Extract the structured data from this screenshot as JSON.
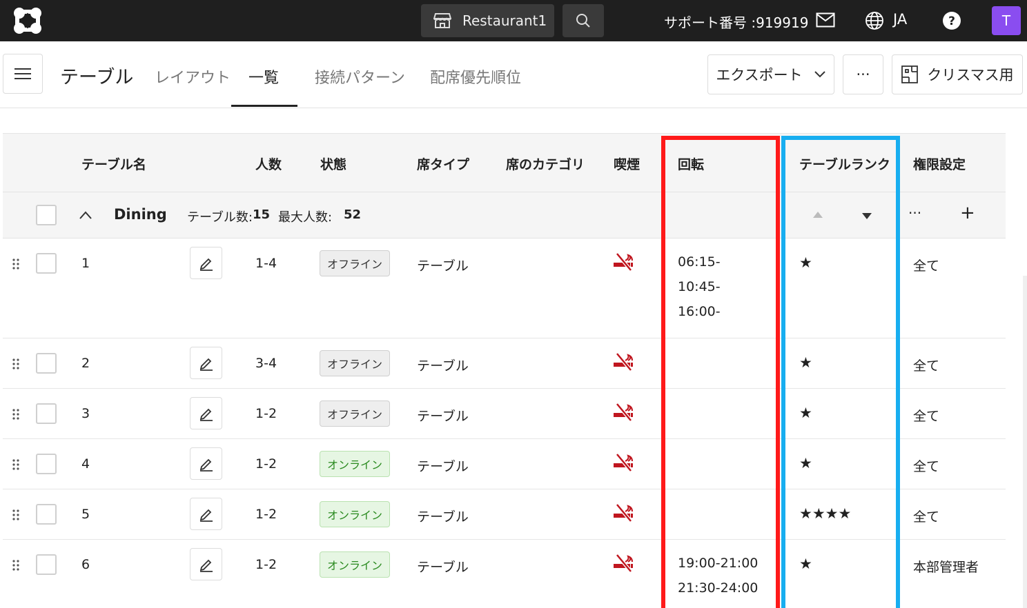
{
  "topbar": {
    "store_name": "Restaurant1",
    "support_label": "サポート番号 :919919",
    "language": "JA",
    "avatar_initial": "T",
    "avatar_color": "#8a4df0"
  },
  "header": {
    "title": "テーブル",
    "tabs": [
      {
        "label": "レイアウト"
      },
      {
        "label": "一覧"
      },
      {
        "label": "接続パターン"
      },
      {
        "label": "配席優先順位"
      }
    ],
    "export_label": "エクスポート",
    "more_label": "···",
    "pattern_label": "クリスマス用"
  },
  "table": {
    "columns": {
      "name": "テーブル名",
      "people": "人数",
      "status": "状態",
      "seat_type": "席タイプ",
      "seat_category": "席のカテゴリ",
      "smoking": "喫煙",
      "rotation": "回転",
      "rank": "テーブルランク",
      "permission": "権限設定"
    },
    "group": {
      "name": "Dining",
      "count_label": "テーブル数:",
      "count_value": "15",
      "max_label": "最大人数:",
      "max_value": "52",
      "more_label": "···",
      "add_label": "+"
    },
    "rows": [
      {
        "name": "1",
        "people": "1-4",
        "status": "オフライン",
        "online": false,
        "seat_type": "テーブル",
        "rotation": [
          "06:15-",
          "10:45-",
          "16:00-"
        ],
        "rank": "★",
        "permission": "全て"
      },
      {
        "name": "2",
        "people": "3-4",
        "status": "オフライン",
        "online": false,
        "seat_type": "テーブル",
        "rotation": [],
        "rank": "★",
        "permission": "全て"
      },
      {
        "name": "3",
        "people": "1-2",
        "status": "オフライン",
        "online": false,
        "seat_type": "テーブル",
        "rotation": [],
        "rank": "★",
        "permission": "全て"
      },
      {
        "name": "4",
        "people": "1-2",
        "status": "オンライン",
        "online": true,
        "seat_type": "テーブル",
        "rotation": [],
        "rank": "★",
        "permission": "全て"
      },
      {
        "name": "5",
        "people": "1-2",
        "status": "オンライン",
        "online": true,
        "seat_type": "テーブル",
        "rotation": [],
        "rank": "★★★★",
        "permission": "全て"
      },
      {
        "name": "6",
        "people": "1-2",
        "status": "オンライン",
        "online": true,
        "seat_type": "テーブル",
        "rotation": [
          "19:00-21:00",
          "21:30-24:00"
        ],
        "rank": "★",
        "permission": "本部管理者"
      }
    ]
  },
  "colors": {
    "highlight_red": "#ff1a1a",
    "highlight_blue": "#18aef0",
    "no_smoking": "#c0161f"
  }
}
